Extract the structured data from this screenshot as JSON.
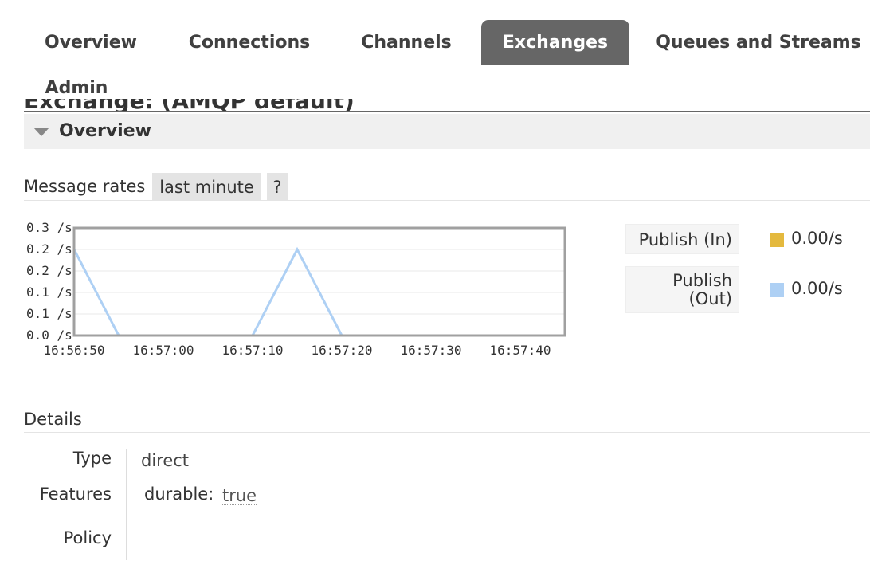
{
  "nav": {
    "tabs": [
      {
        "label": "Overview",
        "active": false
      },
      {
        "label": "Connections",
        "active": false
      },
      {
        "label": "Channels",
        "active": false
      },
      {
        "label": "Exchanges",
        "active": true
      },
      {
        "label": "Queues and Streams",
        "active": false
      },
      {
        "label": "Admin",
        "active": false
      }
    ]
  },
  "page": {
    "title_partial": "Exchange: (AMQP default)"
  },
  "overview": {
    "section_title": "Overview",
    "rates_label": "Message rates",
    "range_button": "last minute",
    "help_button": "?"
  },
  "chart_data": {
    "type": "line",
    "x": [
      "16:56:50",
      "16:56:55",
      "16:57:00",
      "16:57:05",
      "16:57:10",
      "16:57:15",
      "16:57:20",
      "16:57:25",
      "16:57:30",
      "16:57:35",
      "16:57:40",
      "16:57:45"
    ],
    "x_tick_labels": [
      "16:56:50",
      "16:57:00",
      "16:57:10",
      "16:57:20",
      "16:57:30",
      "16:57:40"
    ],
    "y_tick_labels": [
      "0.3 /s",
      "0.2 /s",
      "0.2 /s",
      "0.1 /s",
      "0.1 /s",
      "0.0 /s"
    ],
    "ylim": [
      0,
      0.25
    ],
    "grid": true,
    "series": [
      {
        "name": "Publish (In)",
        "color": "#e4b93e",
        "values": [
          0,
          0,
          0,
          0,
          0,
          0,
          0,
          0,
          0,
          0,
          0,
          0
        ]
      },
      {
        "name": "Publish (Out)",
        "color": "#aed0f4",
        "values": [
          0.2,
          0,
          0,
          0,
          0,
          0.2,
          0,
          0,
          0,
          0,
          0,
          0
        ]
      }
    ]
  },
  "legend": {
    "items": [
      {
        "label": "Publish (In)",
        "color": "#e4b93e",
        "value": "0.00/s"
      },
      {
        "label_line1": "Publish",
        "label_line2": "(Out)",
        "color": "#aed0f4",
        "value": "0.00/s"
      }
    ]
  },
  "details": {
    "heading": "Details",
    "type_label": "Type",
    "type_value": "direct",
    "features_label": "Features",
    "feature_key": "durable:",
    "feature_value": "true",
    "policy_label": "Policy"
  }
}
